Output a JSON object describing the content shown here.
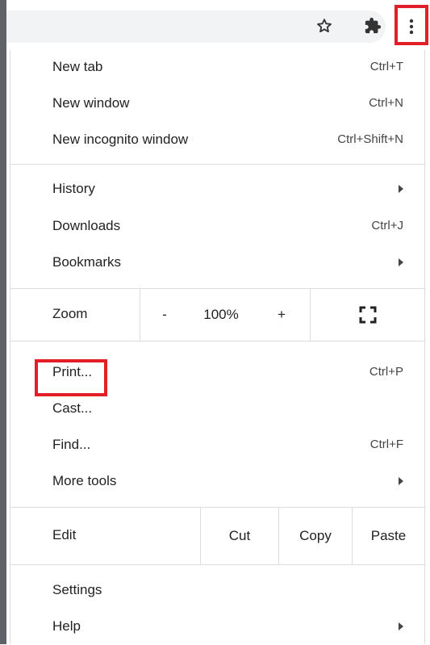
{
  "toolbar": {
    "icons": [
      "star-icon",
      "puzzle-extension-icon",
      "kebab-menu-icon"
    ]
  },
  "menu": {
    "new_tab": {
      "label": "New tab",
      "shortcut": "Ctrl+T"
    },
    "new_window": {
      "label": "New window",
      "shortcut": "Ctrl+N"
    },
    "new_incognito": {
      "label": "New incognito window",
      "shortcut": "Ctrl+Shift+N"
    },
    "history": {
      "label": "History"
    },
    "downloads": {
      "label": "Downloads",
      "shortcut": "Ctrl+J"
    },
    "bookmarks": {
      "label": "Bookmarks"
    },
    "zoom": {
      "label": "Zoom",
      "minus": "-",
      "value": "100%",
      "plus": "+"
    },
    "print": {
      "label": "Print...",
      "shortcut": "Ctrl+P"
    },
    "cast": {
      "label": "Cast..."
    },
    "find": {
      "label": "Find...",
      "shortcut": "Ctrl+F"
    },
    "more_tools": {
      "label": "More tools"
    },
    "edit": {
      "label": "Edit",
      "cut": "Cut",
      "copy": "Copy",
      "paste": "Paste"
    },
    "settings": {
      "label": "Settings"
    },
    "help": {
      "label": "Help"
    }
  },
  "highlight_color": "#e21f26"
}
